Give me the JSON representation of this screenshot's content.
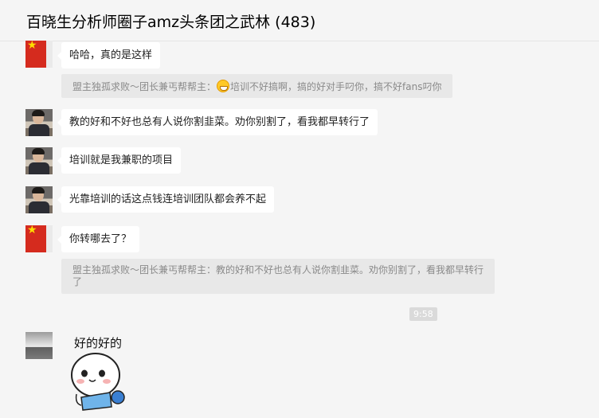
{
  "header": {
    "title": "百晓生分析师圈子amz头条团之武林 (483)"
  },
  "messages": [
    {
      "avatar": "flag-avatar",
      "text": "哈哈，真的是这样"
    },
    {
      "avatar": "man-photo-avatar",
      "text": "教的好和不好也总有人说你割韭菜。劝你别割了，看我都早转行了"
    },
    {
      "avatar": "man-photo-avatar",
      "text": "培训就是我兼职的项目"
    },
    {
      "avatar": "man-photo-avatar",
      "text": "光靠培训的话这点钱连培训团队都会养不起"
    },
    {
      "avatar": "flag-avatar",
      "text": "你转哪去了？"
    },
    {
      "avatar": "landscape-avatar",
      "text": "好的好的"
    }
  ],
  "quotes": {
    "q1_prefix": "盟主独孤求败～团长兼丐帮帮主：",
    "q1_suffix": "培训不好搞啊，搞的好对手叼你，搞不好fans叼你",
    "q2_line1": "盟主独孤求败～团长兼丐帮帮主：教的好和不好也总有人说你割韭菜。劝你别割了，看我都早转行",
    "q2_line2": "了"
  },
  "timestamp": "9:58",
  "icons": {
    "grin_emoji": "grinning-face-icon",
    "sticker": "cartoon-sticker-laptop"
  },
  "colors": {
    "background": "#f5f5f5",
    "bubble": "#ffffff",
    "quote_bg": "#e8e8e8",
    "quote_text": "#8a8a8a"
  }
}
